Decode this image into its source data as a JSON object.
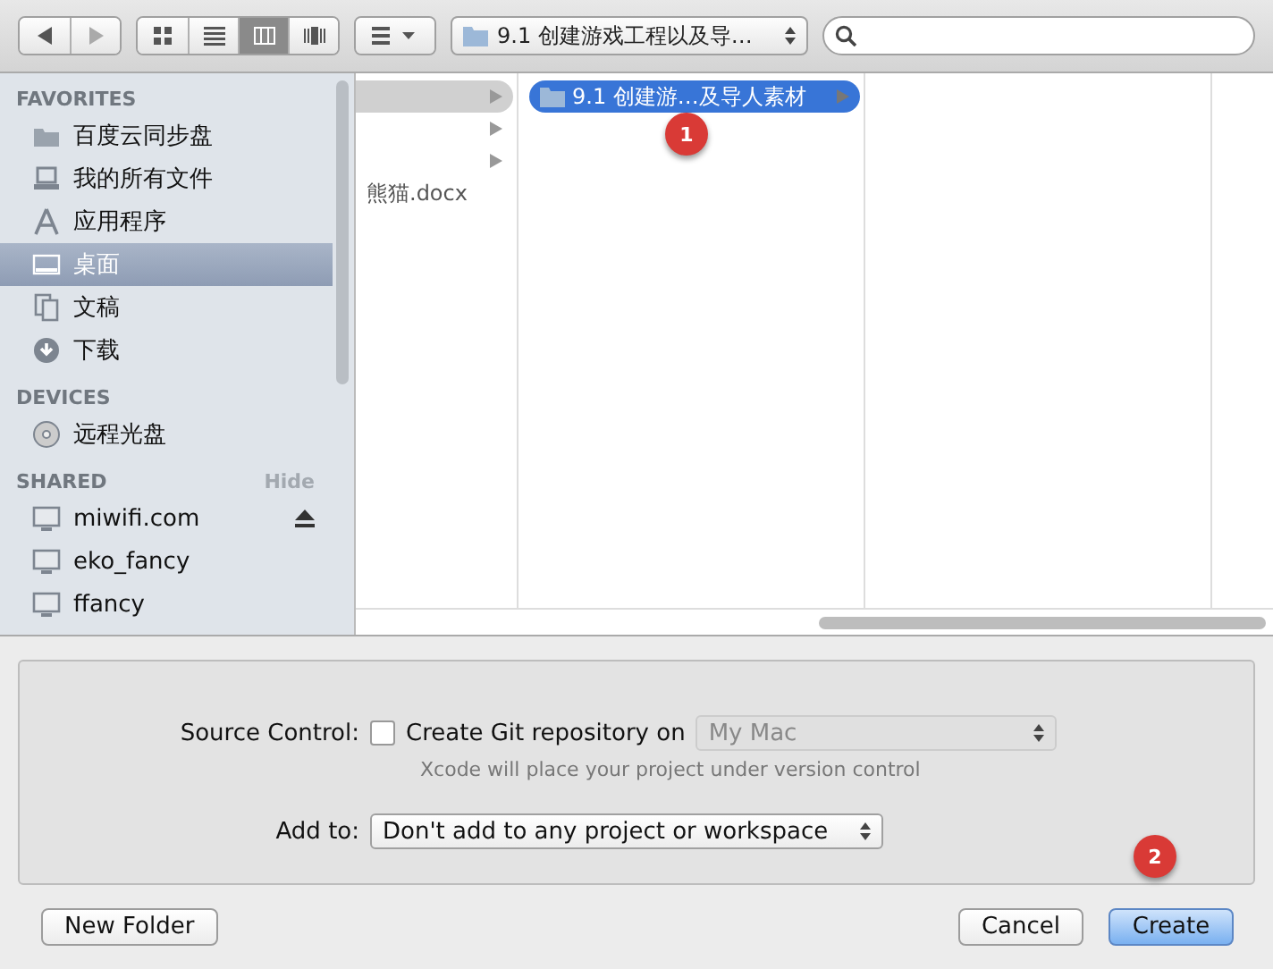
{
  "toolbar": {
    "nav": [
      {
        "kind": "back",
        "disabled": false
      },
      {
        "kind": "forward",
        "disabled": true
      }
    ],
    "views": [
      {
        "kind": "icons",
        "selected": false
      },
      {
        "kind": "list",
        "selected": false
      },
      {
        "kind": "columns",
        "selected": true
      },
      {
        "kind": "coverflow",
        "selected": false
      }
    ],
    "path": "9.1 创建游戏工程以及导…"
  },
  "sidebar": {
    "sections": [
      {
        "title": "FAVORITES",
        "items": [
          {
            "label": "百度云同步盘",
            "kind": "folder",
            "selected": false
          },
          {
            "label": "我的所有文件",
            "kind": "files",
            "selected": false
          },
          {
            "label": "应用程序",
            "kind": "apps",
            "selected": false
          },
          {
            "label": "桌面",
            "kind": "desktop",
            "selected": true
          },
          {
            "label": "文稿",
            "kind": "documents",
            "selected": false
          },
          {
            "label": "下载",
            "kind": "download",
            "selected": false
          }
        ]
      },
      {
        "title": "DEVICES",
        "items": [
          {
            "label": "远程光盘",
            "kind": "disc",
            "selected": false
          }
        ]
      },
      {
        "title": "SHARED",
        "action": "Hide",
        "items": [
          {
            "label": "miwifi.com",
            "kind": "monitor",
            "selected": false,
            "eject": true
          },
          {
            "label": "eko_fancy",
            "kind": "monitor",
            "selected": false,
            "eject": false
          },
          {
            "label": "ffancy",
            "kind": "monitor",
            "selected": false,
            "eject": false
          }
        ]
      }
    ]
  },
  "columns": [
    {
      "items": [
        {
          "selected": true,
          "folder": true
        },
        {
          "selected": false,
          "folder": true
        },
        {
          "selected": false,
          "folder": true
        },
        {
          "label": "熊猫.docx",
          "selected": false,
          "folder": false
        }
      ]
    },
    {
      "items": [
        {
          "label": "9.1 创建游…及导人素材",
          "selected": true,
          "folder": true
        }
      ]
    }
  ],
  "badges": [
    "1",
    "2"
  ],
  "options": {
    "source_control": {
      "label": "Source Control:",
      "checked": false,
      "checkbox_label": "Create Git repository on",
      "popup": "My Mac",
      "popup_disabled": true,
      "hint": "Xcode will place your project under version control"
    },
    "add_to": {
      "label": "Add to:",
      "popup": "Don't add to any project or workspace"
    }
  },
  "buttons": [
    {
      "label": "New Folder",
      "default": false
    },
    {
      "label": "Cancel",
      "default": false
    },
    {
      "label": "Create",
      "default": true
    }
  ]
}
